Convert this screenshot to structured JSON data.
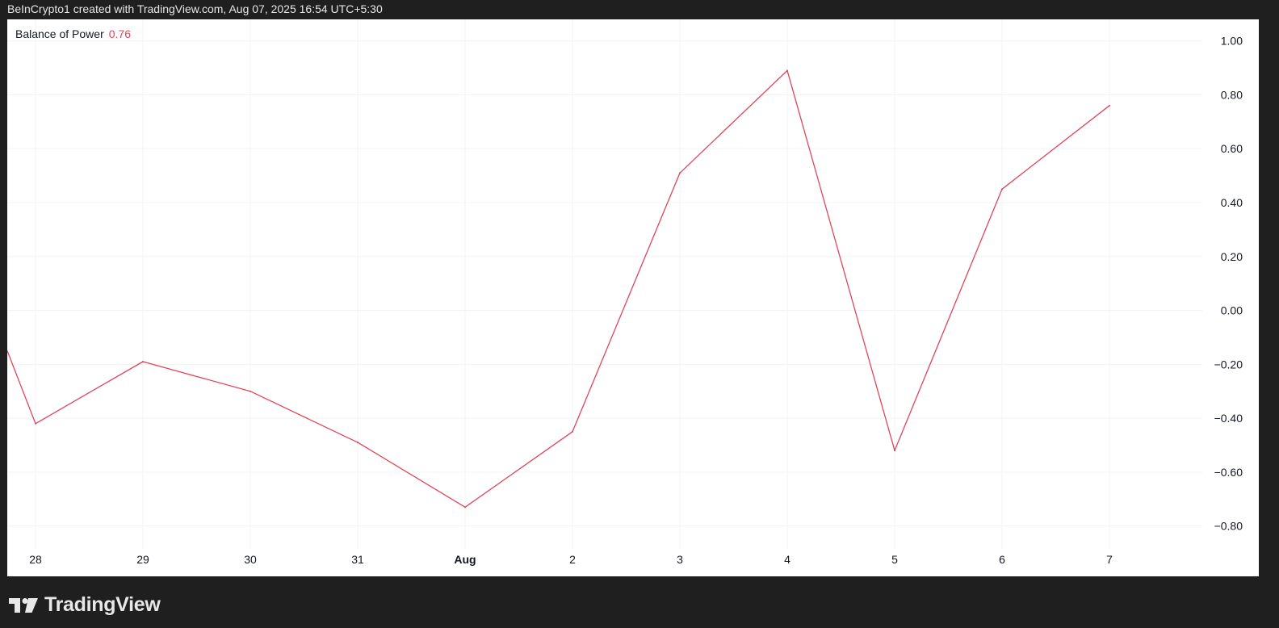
{
  "header": {
    "attribution": "BeInCrypto1 created with TradingView.com, Aug 07, 2025 16:54 UTC+5:30"
  },
  "legend": {
    "name": "Balance of Power",
    "value": "0.76"
  },
  "brand": {
    "wordmark": "TradingView",
    "icon": "tradingview-logo-icon"
  },
  "colors": {
    "line": "#e0455c",
    "grid": "#f0f3f7",
    "axis_text": "#131722",
    "background": "#ffffff",
    "frame": "#1f1f1f"
  },
  "chart_data": {
    "type": "line",
    "title": "",
    "xlabel": "",
    "ylabel": "",
    "categories": [
      "28",
      "29",
      "30",
      "31",
      "Aug",
      "2",
      "3",
      "4",
      "5",
      "6",
      "7"
    ],
    "category_bold": [
      false,
      false,
      false,
      false,
      true,
      false,
      false,
      false,
      false,
      false,
      false
    ],
    "series": [
      {
        "name": "Balance of Power",
        "leading_value": -0.15,
        "values": [
          -0.42,
          -0.19,
          -0.3,
          -0.49,
          -0.73,
          -0.45,
          0.51,
          0.89,
          -0.52,
          0.45,
          0.76
        ]
      }
    ],
    "yticks": [
      "1.00",
      "0.80",
      "0.60",
      "0.40",
      "0.20",
      "0.00",
      "−0.20",
      "−0.40",
      "−0.60",
      "−0.80"
    ],
    "ytick_values": [
      1.0,
      0.8,
      0.6,
      0.4,
      0.2,
      0.0,
      -0.2,
      -0.4,
      -0.6,
      -0.8
    ],
    "ylim": [
      -0.885,
      1.08
    ],
    "grid": true,
    "y_axis_side": "right",
    "legend_position": "top-left"
  }
}
